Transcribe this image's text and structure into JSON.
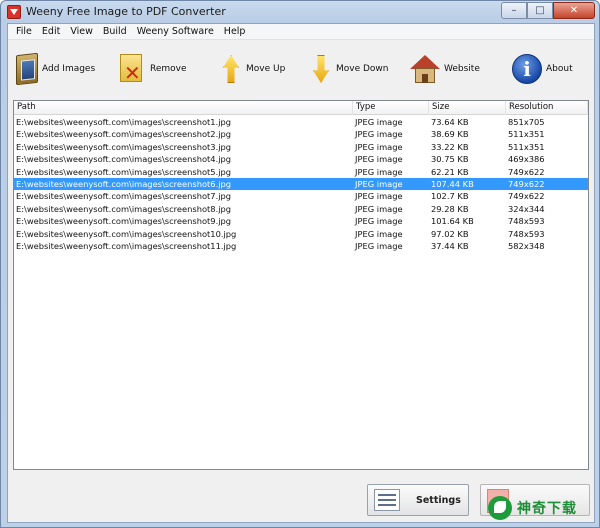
{
  "window": {
    "title": "Weeny Free Image to PDF Converter",
    "controls": {
      "minimize": "–",
      "maximize": "□",
      "close": "✕"
    }
  },
  "menu": [
    "File",
    "Edit",
    "View",
    "Build",
    "Weeny Software",
    "Help"
  ],
  "toolbar": {
    "add_images": "Add Images",
    "remove": "Remove",
    "move_up": "Move Up",
    "move_down": "Move Down",
    "website": "Website",
    "about": "About"
  },
  "list": {
    "columns": [
      "Path",
      "Type",
      "Size",
      "Resolution"
    ],
    "selected_index": 5,
    "rows": [
      {
        "path": "E:\\websites\\weenysoft.com\\images\\screenshot1.jpg",
        "type": "JPEG image",
        "size": "73.64 KB",
        "resolution": "851x705"
      },
      {
        "path": "E:\\websites\\weenysoft.com\\images\\screenshot2.jpg",
        "type": "JPEG image",
        "size": "38.69 KB",
        "resolution": "511x351"
      },
      {
        "path": "E:\\websites\\weenysoft.com\\images\\screenshot3.jpg",
        "type": "JPEG image",
        "size": "33.22 KB",
        "resolution": "511x351"
      },
      {
        "path": "E:\\websites\\weenysoft.com\\images\\screenshot4.jpg",
        "type": "JPEG image",
        "size": "30.75 KB",
        "resolution": "469x386"
      },
      {
        "path": "E:\\websites\\weenysoft.com\\images\\screenshot5.jpg",
        "type": "JPEG image",
        "size": "62.21 KB",
        "resolution": "749x622"
      },
      {
        "path": "E:\\websites\\weenysoft.com\\images\\screenshot6.jpg",
        "type": "JPEG image",
        "size": "107.44 KB",
        "resolution": "749x622"
      },
      {
        "path": "E:\\websites\\weenysoft.com\\images\\screenshot7.jpg",
        "type": "JPEG image",
        "size": "102.7 KB",
        "resolution": "749x622"
      },
      {
        "path": "E:\\websites\\weenysoft.com\\images\\screenshot8.jpg",
        "type": "JPEG image",
        "size": "29.28 KB",
        "resolution": "324x344"
      },
      {
        "path": "E:\\websites\\weenysoft.com\\images\\screenshot9.jpg",
        "type": "JPEG image",
        "size": "101.64 KB",
        "resolution": "748x593"
      },
      {
        "path": "E:\\websites\\weenysoft.com\\images\\screenshot10.jpg",
        "type": "JPEG image",
        "size": "97.02 KB",
        "resolution": "748x593"
      },
      {
        "path": "E:\\websites\\weenysoft.com\\images\\screenshot11.jpg",
        "type": "JPEG image",
        "size": "37.44 KB",
        "resolution": "582x348"
      }
    ]
  },
  "buttons": {
    "settings": "Settings"
  },
  "watermark": {
    "text": "神奇下载"
  },
  "colors": {
    "selection": "#3399ff",
    "window_frame": "#b9cde6",
    "close_button": "#c7432a"
  },
  "icons": {
    "app": "pdf-app-icon",
    "add_images": "picture-frame-icon",
    "remove": "document-remove-icon",
    "move_up": "arrow-up-icon",
    "move_down": "arrow-down-icon",
    "website": "house-icon",
    "about": "info-icon",
    "settings": "settings-list-icon"
  }
}
